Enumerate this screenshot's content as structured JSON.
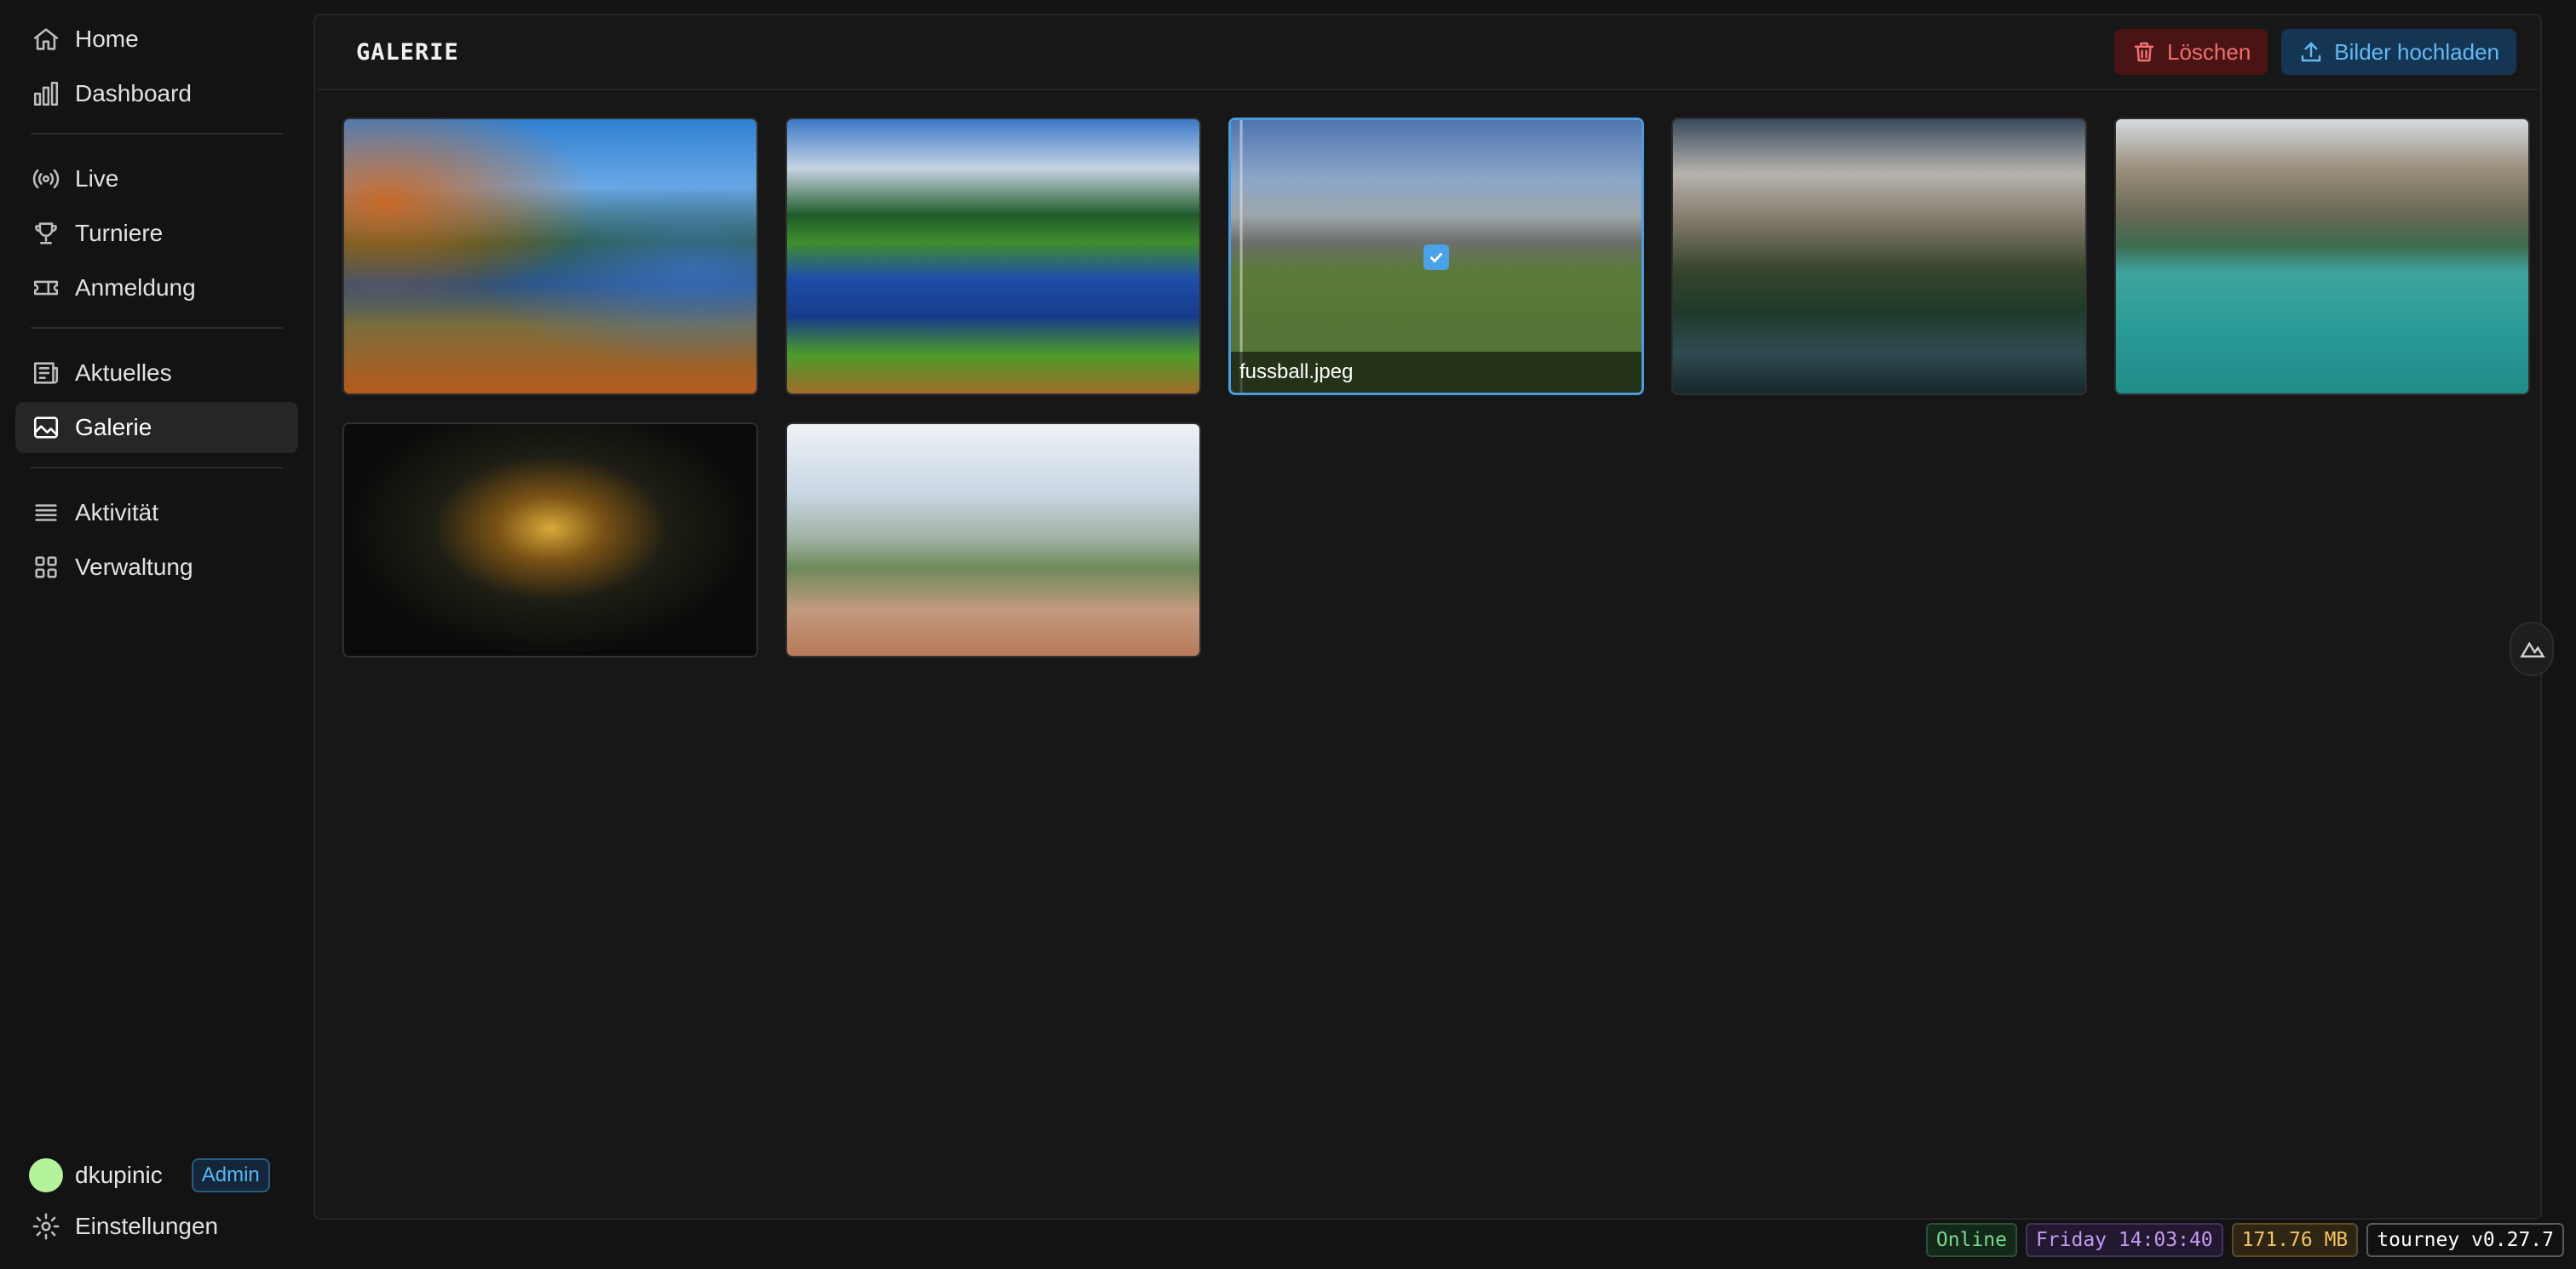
{
  "sidebar": {
    "items": [
      {
        "label": "Home",
        "icon": "home-icon"
      },
      {
        "label": "Dashboard",
        "icon": "bar-chart-icon"
      },
      {
        "label": "Live",
        "icon": "broadcast-icon"
      },
      {
        "label": "Turniere",
        "icon": "trophy-icon"
      },
      {
        "label": "Anmeldung",
        "icon": "ticket-icon"
      },
      {
        "label": "Aktuelles",
        "icon": "newspaper-icon"
      },
      {
        "label": "Galerie",
        "icon": "image-icon",
        "active": true
      },
      {
        "label": "Aktivität",
        "icon": "list-icon"
      },
      {
        "label": "Verwaltung",
        "icon": "grid-icon"
      }
    ],
    "user": {
      "name": "dkupinic",
      "role": "Admin",
      "avatar_color": "#b5f29c"
    },
    "settings_label": "Einstellungen"
  },
  "header": {
    "title": "GALERIE",
    "delete_label": "Löschen",
    "upload_label": "Bilder hochladen"
  },
  "gallery": {
    "images": [
      {
        "scene": "autumn lake with mountains"
      },
      {
        "scene": "mountain lake with pine trees"
      },
      {
        "scene": "football field team photo",
        "filename": "fussball.jpeg",
        "selected": true
      },
      {
        "scene": "dolomites lake with boathouse"
      },
      {
        "scene": "turquoise lake with rowing boat"
      },
      {
        "scene": "golden trophy in stadium"
      },
      {
        "scene": "volleyball match"
      }
    ]
  },
  "status": {
    "online": "Online",
    "time": "Friday 14:03:40",
    "memory": "171.76 MB",
    "version": "tourney v0.27.7"
  },
  "colors": {
    "accent": "#4b9de0",
    "danger": "#ef6f6f",
    "background": "#131313"
  }
}
